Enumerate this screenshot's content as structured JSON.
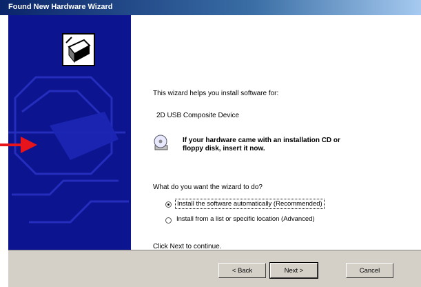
{
  "window": {
    "title": "Found New Hardware Wizard"
  },
  "content": {
    "intro": "This wizard helps you install software for:",
    "device_name": "2D USB Composite Device",
    "cd_notice_line1": "If your hardware came with an installation CD or",
    "cd_notice_line2": "floppy disk, insert it now.",
    "question": "What do you want the wizard to do?",
    "options": [
      {
        "label": "Install the software automatically (Recommended)",
        "selected": true
      },
      {
        "label": "Install from a list or specific location (Advanced)",
        "selected": false
      }
    ],
    "continue_hint": "Click Next to continue."
  },
  "buttons": {
    "back": "< Back",
    "next": "Next >",
    "cancel": "Cancel"
  },
  "colors": {
    "sidebar": "#0c1490",
    "arrow": "#e8141c",
    "footer": "#d4d0c8"
  },
  "icons": [
    "hardware-wizard-icon",
    "cd-disk-icon",
    "pointer-arrow-icon"
  ]
}
